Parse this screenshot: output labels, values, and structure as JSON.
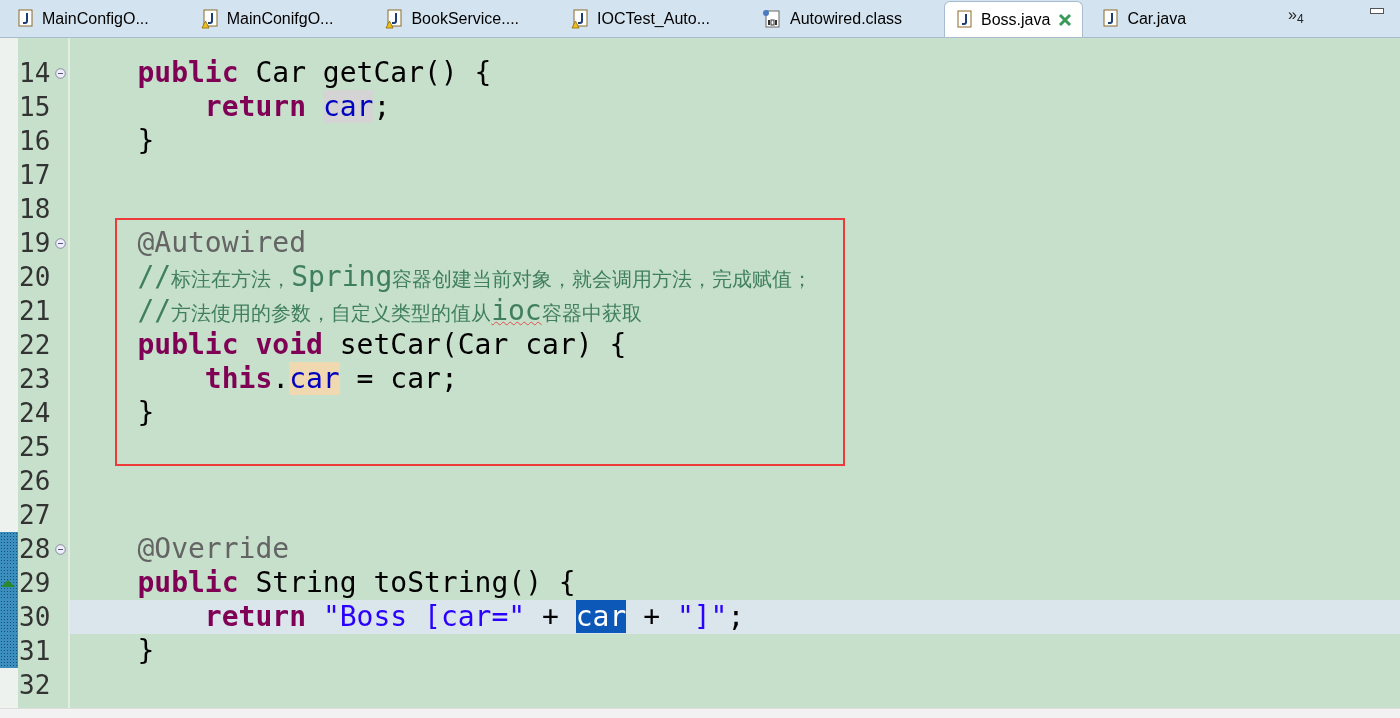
{
  "tabs": [
    {
      "label": "MainConfigO...",
      "kind": "java",
      "selected": false
    },
    {
      "label": "MainConifgO...",
      "kind": "java-warning",
      "selected": false
    },
    {
      "label": "BookService....",
      "kind": "java-warning",
      "selected": false
    },
    {
      "label": "IOCTest_Auto...",
      "kind": "java-warning",
      "selected": false
    },
    {
      "label": "Autowired.class",
      "kind": "class",
      "selected": false
    },
    {
      "label": "Boss.java",
      "kind": "java",
      "selected": true,
      "closable": true
    },
    {
      "label": "Car.java",
      "kind": "java",
      "selected": false
    }
  ],
  "overflow": {
    "symbol": "»",
    "count": "4"
  },
  "blocks": [
    {
      "lines": [
        {
          "number": "14",
          "fold": true,
          "tokens": [
            {
              "kind": "keyword",
              "text": "    public"
            },
            {
              "kind": "plain",
              "text": " Car getCar() {"
            }
          ]
        },
        {
          "number": "15",
          "tokens": [
            {
              "kind": "keyword",
              "text": "        return"
            },
            {
              "kind": "field-read",
              "text": "car"
            },
            {
              "kind": "plain",
              "text": ";"
            }
          ]
        },
        {
          "number": "16",
          "tokens": [
            {
              "kind": "plain",
              "text": "    }"
            }
          ]
        },
        {
          "number": "17"
        },
        {
          "number": "18"
        }
      ]
    },
    {
      "boxed": true,
      "lines": [
        {
          "number": "19",
          "fold": true,
          "tokens": [
            {
              "kind": "annotation",
              "text": "    @Autowired"
            }
          ]
        },
        {
          "number": "20",
          "tokens": [
            {
              "kind": "comment",
              "text": "    //"
            },
            {
              "kind": "comment-cjk",
              "text": "标注在方法，"
            },
            {
              "kind": "comment",
              "text": "Spring"
            },
            {
              "kind": "comment-cjk",
              "text": "容器创建当前对象，就会调用方法，完成赋值；"
            }
          ]
        },
        {
          "number": "21",
          "tokens": [
            {
              "kind": "comment",
              "text": "    //"
            },
            {
              "kind": "comment-cjk",
              "text": "方法使用的参数，自定义类型的值从"
            },
            {
              "kind": "comment",
              "text": "ioc",
              "misspelled": true
            },
            {
              "kind": "comment-cjk",
              "text": "容器中获取"
            }
          ]
        },
        {
          "number": "22",
          "tokens": [
            {
              "kind": "keyword",
              "text": "    public"
            },
            {
              "kind": "keyword",
              "text": "void"
            },
            {
              "kind": "plain",
              "text": "setCar(Car car) {"
            }
          ]
        },
        {
          "number": "23",
          "tokens": [
            {
              "kind": "keyword",
              "text": "        this"
            },
            {
              "kind": "plain",
              "text": "."
            },
            {
              "kind": "field-write",
              "text": "car"
            },
            {
              "kind": "plain",
              "text": " = car;"
            }
          ]
        },
        {
          "number": "24",
          "tokens": [
            {
              "kind": "plain",
              "text": "    }"
            }
          ]
        },
        {
          "number": "25"
        }
      ]
    },
    {
      "lines": [
        {
          "number": "26"
        },
        {
          "number": "27"
        },
        {
          "number": "28",
          "fold": true,
          "marked": true,
          "tokens": [
            {
              "kind": "annotation",
              "text": "    @Override"
            }
          ]
        },
        {
          "number": "29",
          "override": true,
          "marked": true,
          "tokens": [
            {
              "kind": "keyword",
              "text": "    public"
            },
            {
              "kind": "plain",
              "text": "String toString() {"
            }
          ]
        },
        {
          "number": "30",
          "marked": true,
          "current": true,
          "tokens": [
            {
              "kind": "keyword",
              "text": "        return"
            },
            {
              "kind": "string",
              "text": "\"Boss [car=\""
            },
            {
              "kind": "plain",
              "text": "+"
            },
            {
              "kind": "field-selected",
              "text": "car"
            },
            {
              "kind": "plain",
              "text": "+"
            },
            {
              "kind": "string",
              "text": "\"]\""
            },
            {
              "kind": "plain",
              "text": ";"
            }
          ]
        },
        {
          "number": "31",
          "marked": true,
          "tokens": [
            {
              "kind": "plain",
              "text": "    }"
            }
          ]
        },
        {
          "number": "32"
        }
      ]
    }
  ]
}
